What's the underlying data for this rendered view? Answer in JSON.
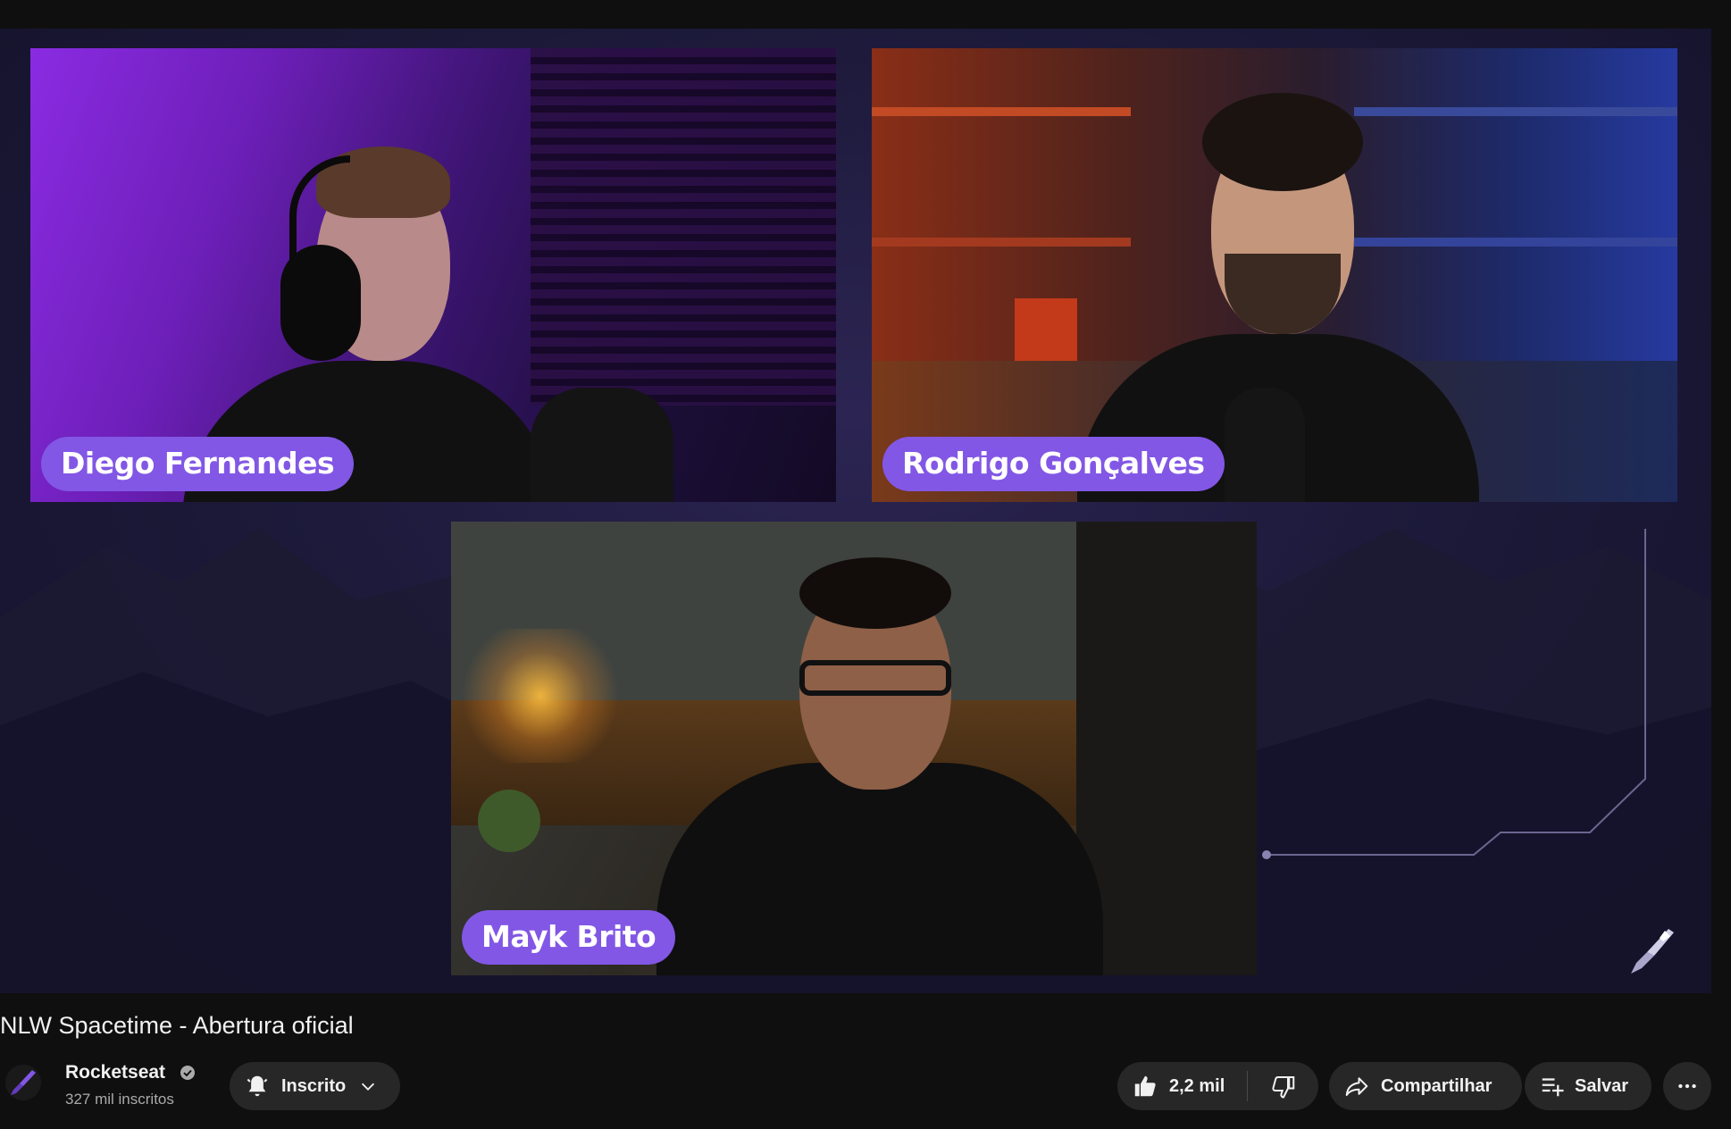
{
  "video": {
    "title": "NLW Spacetime - Abertura oficial",
    "participants": [
      "Diego Fernandes",
      "Rodrigo Gonçalves",
      "Mayk Brito"
    ]
  },
  "channel": {
    "name": "Rocketseat",
    "subscribers": "327 mil inscritos",
    "verified": true
  },
  "actions": {
    "subscribe_label": "Inscrito",
    "likes": "2,2 mil",
    "share_label": "Compartilhar",
    "save_label": "Salvar"
  },
  "colors": {
    "name_tag": "#8257e5",
    "button_bg": "#272727",
    "page_bg": "#0f0f0f"
  },
  "icons": [
    "bell-icon",
    "chevron-down-icon",
    "thumbs-up-icon",
    "thumbs-down-icon",
    "share-icon",
    "playlist-add-icon",
    "more-icon",
    "verified-icon",
    "rocket-icon"
  ]
}
